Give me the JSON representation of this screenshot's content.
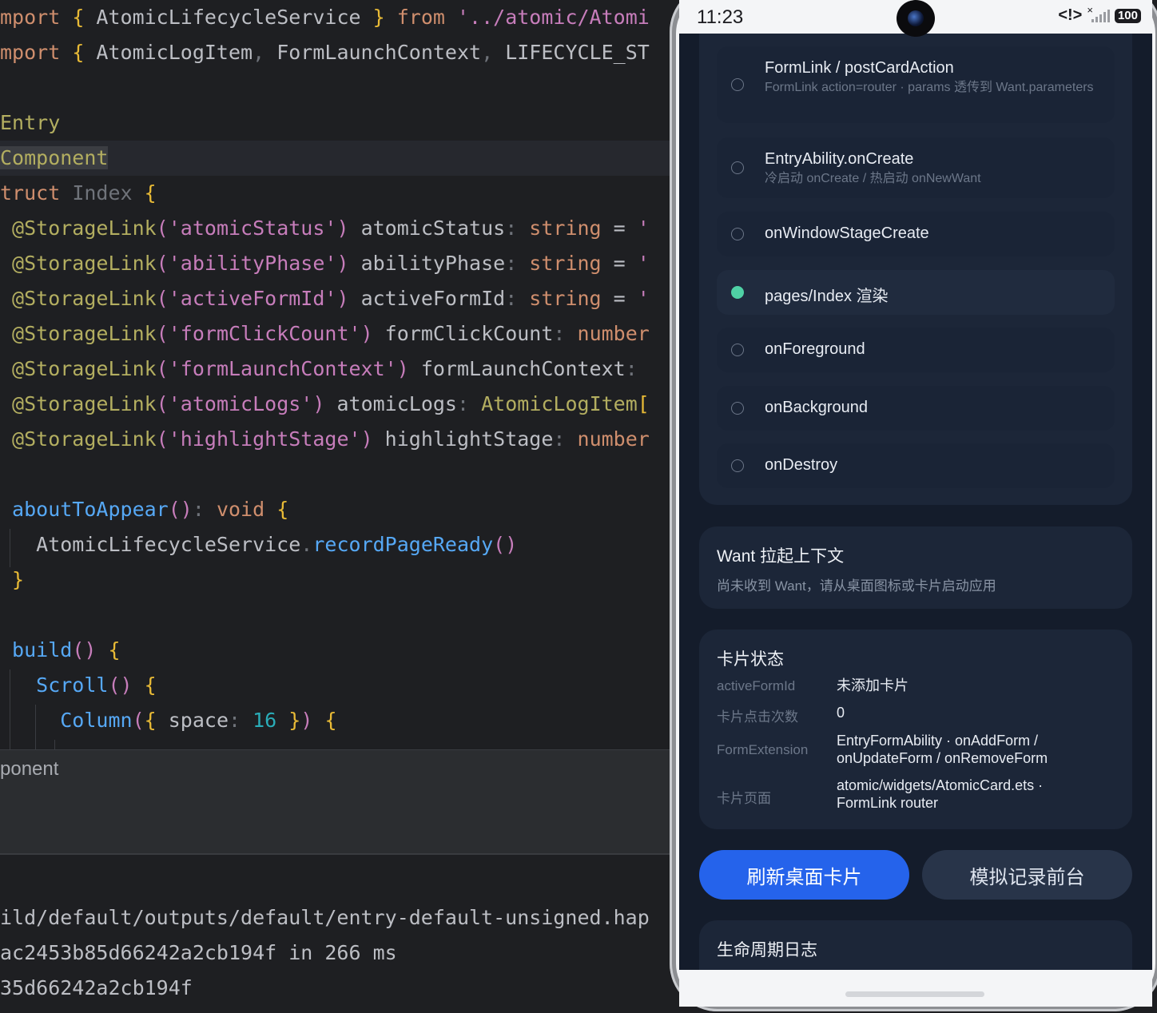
{
  "editor": {
    "lines": [
      {
        "tokens": [
          [
            "tk-kw",
            "mport "
          ],
          [
            "tk-brace",
            "{ "
          ],
          [
            "",
            "AtomicLifecycleService "
          ],
          [
            "tk-brace",
            "} "
          ],
          [
            "tk-kw",
            "from "
          ],
          [
            "tk-strp",
            "'../atomic/Atomi"
          ]
        ]
      },
      {
        "tokens": [
          [
            "tk-kw",
            "mport "
          ],
          [
            "tk-brace",
            "{ "
          ],
          [
            "",
            "AtomicLogItem"
          ],
          [
            "tk-gray",
            ", "
          ],
          [
            "",
            "FormLaunchContext"
          ],
          [
            "tk-gray",
            ", "
          ],
          [
            "",
            "LIFECYCLE_ST"
          ]
        ]
      },
      {
        "tokens": []
      },
      {
        "tokens": [
          [
            "tk-dec",
            "Entry"
          ]
        ]
      },
      {
        "tokens": [
          [
            "tk-dec tk-hl-word",
            "Component"
          ]
        ],
        "highlight": true
      },
      {
        "tokens": [
          [
            "tk-kw",
            "truct "
          ],
          [
            "tk-gray",
            "Index "
          ],
          [
            "tk-brace",
            "{"
          ]
        ]
      },
      {
        "tokens": [
          [
            "tk-ann",
            " @StorageLink"
          ],
          [
            "tk-paren",
            "("
          ],
          [
            "tk-strp",
            "'atomicStatus'"
          ],
          [
            "tk-paren",
            ")"
          ],
          [
            "",
            " atomicStatus"
          ],
          [
            "tk-gray",
            ": "
          ],
          [
            "tk-type",
            "string "
          ],
          [
            "",
            "= "
          ],
          [
            "tk-strp",
            "'"
          ]
        ]
      },
      {
        "tokens": [
          [
            "tk-ann",
            " @StorageLink"
          ],
          [
            "tk-paren",
            "("
          ],
          [
            "tk-strp",
            "'abilityPhase'"
          ],
          [
            "tk-paren",
            ")"
          ],
          [
            "",
            " abilityPhase"
          ],
          [
            "tk-gray",
            ": "
          ],
          [
            "tk-type",
            "string "
          ],
          [
            "",
            "= "
          ],
          [
            "tk-strp",
            "'"
          ]
        ]
      },
      {
        "tokens": [
          [
            "tk-ann",
            " @StorageLink"
          ],
          [
            "tk-paren",
            "("
          ],
          [
            "tk-strp",
            "'activeFormId'"
          ],
          [
            "tk-paren",
            ")"
          ],
          [
            "",
            " activeFormId"
          ],
          [
            "tk-gray",
            ": "
          ],
          [
            "tk-type",
            "string "
          ],
          [
            "",
            "= "
          ],
          [
            "tk-strp",
            "'"
          ]
        ]
      },
      {
        "tokens": [
          [
            "tk-ann",
            " @StorageLink"
          ],
          [
            "tk-paren",
            "("
          ],
          [
            "tk-strp",
            "'formClickCount'"
          ],
          [
            "tk-paren",
            ")"
          ],
          [
            "",
            " formClickCount"
          ],
          [
            "tk-gray",
            ": "
          ],
          [
            "tk-type",
            "number"
          ]
        ]
      },
      {
        "tokens": [
          [
            "tk-ann",
            " @StorageLink"
          ],
          [
            "tk-paren",
            "("
          ],
          [
            "tk-strp",
            "'formLaunchContext'"
          ],
          [
            "tk-paren",
            ")"
          ],
          [
            "",
            " formLaunchContext"
          ],
          [
            "tk-gray",
            ":"
          ]
        ]
      },
      {
        "tokens": [
          [
            "tk-ann",
            " @StorageLink"
          ],
          [
            "tk-paren",
            "("
          ],
          [
            "tk-strp",
            "'atomicLogs'"
          ],
          [
            "tk-paren",
            ")"
          ],
          [
            "",
            " atomicLogs"
          ],
          [
            "tk-gray",
            ": "
          ],
          [
            "tk-ann",
            "AtomicLogItem"
          ],
          [
            "tk-brace",
            "["
          ]
        ]
      },
      {
        "tokens": [
          [
            "tk-ann",
            " @StorageLink"
          ],
          [
            "tk-paren",
            "("
          ],
          [
            "tk-strp",
            "'highlightStage'"
          ],
          [
            "tk-paren",
            ")"
          ],
          [
            "",
            " highlightStage"
          ],
          [
            "tk-gray",
            ": "
          ],
          [
            "tk-type",
            "number"
          ]
        ]
      },
      {
        "tokens": []
      },
      {
        "tokens": [
          [
            "tk-fn",
            " aboutToAppear"
          ],
          [
            "tk-paren",
            "()"
          ],
          [
            "tk-gray",
            ": "
          ],
          [
            "tk-type",
            "void "
          ],
          [
            "tk-brace",
            "{"
          ]
        ]
      },
      {
        "tokens": [
          [
            "",
            "   AtomicLifecycleService"
          ],
          [
            "tk-gray",
            "."
          ],
          [
            "tk-fn",
            "recordPageReady"
          ],
          [
            "tk-paren",
            "()"
          ]
        ]
      },
      {
        "tokens": [
          [
            "tk-brace",
            " }"
          ]
        ]
      },
      {
        "tokens": []
      },
      {
        "tokens": [
          [
            "tk-fn",
            " build"
          ],
          [
            "tk-paren",
            "() "
          ],
          [
            "tk-brace",
            "{"
          ]
        ]
      },
      {
        "tokens": [
          [
            "tk-fn",
            "   Scroll"
          ],
          [
            "tk-paren",
            "() "
          ],
          [
            "tk-brace",
            "{"
          ]
        ]
      },
      {
        "tokens": [
          [
            "tk-fn",
            "     Column"
          ],
          [
            "tk-paren",
            "("
          ],
          [
            "tk-brace",
            "{ "
          ],
          [
            "",
            "space"
          ],
          [
            "tk-gray",
            ": "
          ],
          [
            "tk-num",
            "16 "
          ],
          [
            "tk-brace",
            "}"
          ],
          [
            "tk-paren",
            ") "
          ],
          [
            "tk-brace",
            "{"
          ]
        ]
      }
    ]
  },
  "breadcrumb": "ponent",
  "console": {
    "lines": [
      "ild/default/outputs/default/entry-default-unsigned.hap",
      "ac2453b85d66242a2cb194f in 266 ms",
      "35d66242a2cb194f"
    ]
  },
  "phone": {
    "status": {
      "time": "11:23",
      "net": "<!>",
      "signal_x": "×",
      "battery": "100"
    },
    "stages": [
      {
        "title": "FormLink / postCardAction",
        "sub": "FormLink action=router · params 透传到 Want.parameters",
        "active": false
      },
      {
        "title": "EntryAbility.onCreate",
        "sub": "冷启动 onCreate / 热启动 onNewWant",
        "active": false
      },
      {
        "title": "onWindowStageCreate",
        "sub": "",
        "active": false
      },
      {
        "title": "pages/Index 渲染",
        "sub": "",
        "active": true
      },
      {
        "title": "onForeground",
        "sub": "",
        "active": false
      },
      {
        "title": "onBackground",
        "sub": "",
        "active": false
      },
      {
        "title": "onDestroy",
        "sub": "",
        "active": false
      }
    ],
    "want_card": {
      "title": "Want 拉起上下文",
      "text": "尚未收到 Want，请从桌面图标或卡片启动应用"
    },
    "form_card": {
      "title": "卡片状态",
      "rows": [
        {
          "key": "activeFormId",
          "value": "未添加卡片"
        },
        {
          "key": "卡片点击次数",
          "value": "0"
        },
        {
          "key": "FormExtension",
          "value": "EntryFormAbility · onAddForm / onUpdateForm / onRemoveForm"
        },
        {
          "key": "卡片页面",
          "value": "atomic/widgets/AtomicCard.ets · FormLink router"
        }
      ]
    },
    "buttons": {
      "refresh": "刷新桌面卡片",
      "foreground": "模拟记录前台"
    },
    "log_card": {
      "title": "生命周期日志"
    },
    "colors": {
      "accent": "#2563eb",
      "active_dot": "#4fd1a5",
      "screen_bg": "#141c2b",
      "card_bg": "#1c2638"
    }
  }
}
